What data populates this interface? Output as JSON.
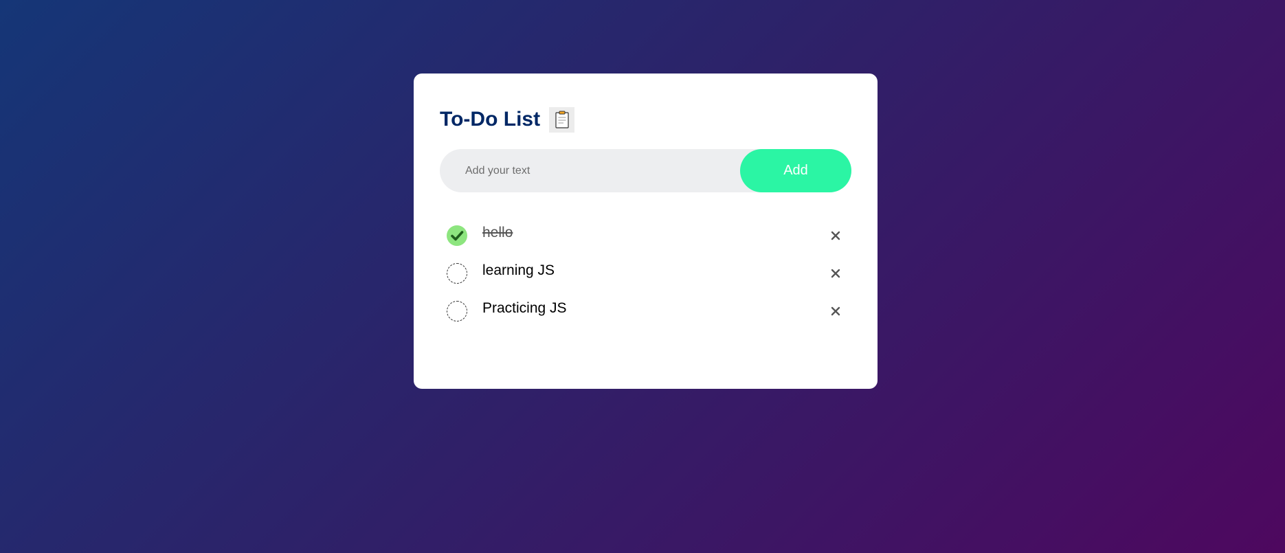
{
  "app": {
    "title": "To-Do List",
    "icon": "clipboard-icon"
  },
  "input": {
    "value": "",
    "placeholder": "Add your text"
  },
  "add_button": {
    "label": "Add"
  },
  "tasks": [
    {
      "text": "hello",
      "checked": true
    },
    {
      "text": "learning JS",
      "checked": false
    },
    {
      "text": "Practicing JS",
      "checked": false
    }
  ],
  "colors": {
    "accent": "#2bf5a4",
    "title": "#002765",
    "checked": "#8de57f",
    "background_start": "#153677",
    "background_end": "#4e085f"
  }
}
